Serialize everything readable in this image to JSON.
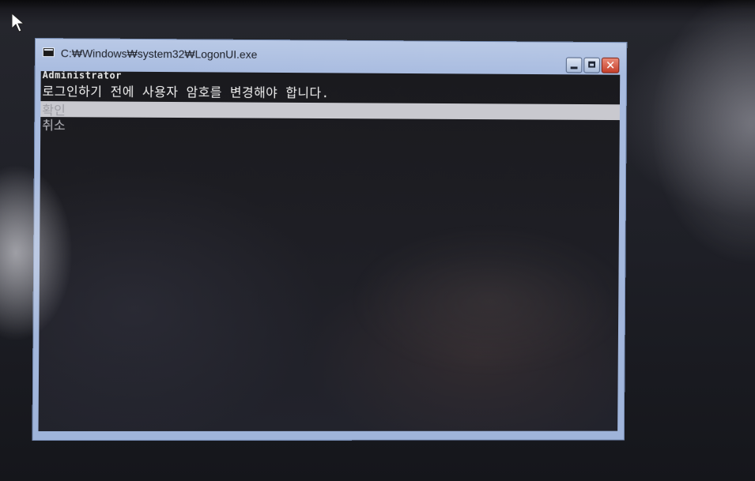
{
  "window": {
    "title": "C:₩Windows₩system32₩LogonUI.exe",
    "close_glyph": "✕"
  },
  "console": {
    "user": "Administrator",
    "message": "로그인하기 전에 사용자 암호를 변경해야 합니다.",
    "options": [
      {
        "label": "확인",
        "selected": true
      },
      {
        "label": "취소",
        "selected": false
      }
    ]
  },
  "icons": [
    "mouse-cursor-icon",
    "console-window-icon",
    "minimize-icon",
    "maximize-icon",
    "close-icon"
  ],
  "colors": {
    "title_bar": "#a9bce0",
    "close_button": "#c5402b",
    "console_background": "#1e1e24",
    "selection": "#c9c9cf"
  }
}
